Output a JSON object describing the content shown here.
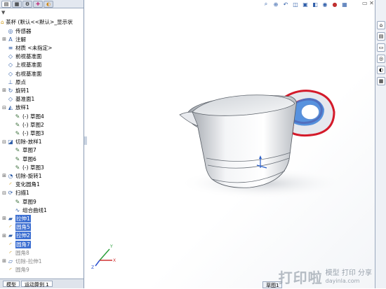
{
  "feature_tree": {
    "root_label": "茶杯 (默认<<默认>_显示状",
    "items": [
      {
        "label": "传感器",
        "icon": "sensor-icon",
        "indent": 0,
        "exp": ""
      },
      {
        "label": "注解",
        "icon": "annotation-icon",
        "indent": 0,
        "exp": "+"
      },
      {
        "label": "材质 <未指定>",
        "icon": "material-icon",
        "indent": 0,
        "exp": ""
      },
      {
        "label": "前视基准面",
        "icon": "plane-icon",
        "indent": 0,
        "exp": ""
      },
      {
        "label": "上视基准面",
        "icon": "plane-icon",
        "indent": 0,
        "exp": ""
      },
      {
        "label": "右视基准面",
        "icon": "plane-icon",
        "indent": 0,
        "exp": ""
      },
      {
        "label": "原点",
        "icon": "origin-icon",
        "indent": 0,
        "exp": ""
      },
      {
        "label": "旋转1",
        "icon": "revolve-icon",
        "indent": 0,
        "exp": "+"
      },
      {
        "label": "基准面1",
        "icon": "plane-icon",
        "indent": 0,
        "exp": ""
      },
      {
        "label": "放样1",
        "icon": "loft-icon",
        "indent": 0,
        "exp": "-"
      },
      {
        "label": "(-) 草图4",
        "icon": "sketch-icon",
        "indent": 1,
        "exp": ""
      },
      {
        "label": "(-) 草图2",
        "icon": "sketch-icon",
        "indent": 1,
        "exp": ""
      },
      {
        "label": "(-) 草图3",
        "icon": "sketch-icon",
        "indent": 1,
        "exp": ""
      },
      {
        "label": "切除-放样1",
        "icon": "cut-loft-icon",
        "indent": 0,
        "exp": "-"
      },
      {
        "label": "草图7",
        "icon": "sketch-icon",
        "indent": 1,
        "exp": ""
      },
      {
        "label": "草图6",
        "icon": "sketch-icon",
        "indent": 1,
        "exp": ""
      },
      {
        "label": "(-) 草图3",
        "icon": "sketch-icon",
        "indent": 1,
        "exp": ""
      },
      {
        "label": "切除-旋转1",
        "icon": "cut-revolve-icon",
        "indent": 0,
        "exp": "+"
      },
      {
        "label": "变化圆角1",
        "icon": "fillet-icon",
        "indent": 0,
        "exp": ""
      },
      {
        "label": "扫描1",
        "icon": "sweep-icon",
        "indent": 0,
        "exp": "-"
      },
      {
        "label": "草图9",
        "icon": "sketch-icon",
        "indent": 1,
        "exp": ""
      },
      {
        "label": "组合曲线1",
        "icon": "curve-icon",
        "indent": 1,
        "exp": ""
      },
      {
        "label": "拉伸1",
        "icon": "extrude-icon",
        "indent": 0,
        "exp": "+",
        "selected": true
      },
      {
        "label": "圆角5",
        "icon": "fillet-icon",
        "indent": 0,
        "exp": "",
        "selected": true
      },
      {
        "label": "拉伸2",
        "icon": "extrude-icon",
        "indent": 0,
        "exp": "+",
        "selected": true
      },
      {
        "label": "圆角7",
        "icon": "fillet-icon",
        "indent": 0,
        "exp": "",
        "selected": true
      },
      {
        "label": "圆角8",
        "icon": "fillet-icon",
        "indent": 0,
        "exp": "",
        "gray": true
      },
      {
        "label": "切除-拉伸1",
        "icon": "cut-extrude-icon",
        "indent": 0,
        "exp": "+",
        "gray": true
      },
      {
        "label": "圆角9",
        "icon": "fillet-icon",
        "indent": 0,
        "exp": "",
        "gray": true
      }
    ]
  },
  "bottom_tabs": [
    "模型",
    "运动算例 1"
  ],
  "status_text": "草图1",
  "watermark": {
    "big": "打印啦",
    "line1": "模型 打印 分享",
    "line2": "dayinla.com"
  },
  "colors": {
    "selected": "#3d6fd1",
    "handle_red": "#d41a2a",
    "handle_blue": "#3a7fd8"
  }
}
